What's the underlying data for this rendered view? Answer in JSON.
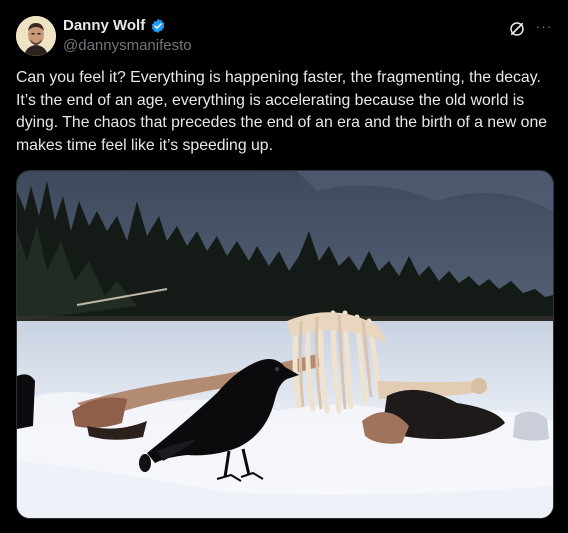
{
  "author": {
    "display_name": "Danny Wolf",
    "handle": "@dannysmanifesto",
    "verified": true,
    "verified_color": "#1d9bf0"
  },
  "header_actions": {
    "grok_icon": "grok-slash-icon",
    "more_label": "···"
  },
  "tweet": {
    "text": "Can you feel it? Everything is happening faster, the fragmenting, the decay. It’s the end of an age, everything is accelerating because the old world is dying. The chaos that precedes the end of an era and the birth of a new one makes time feel like it’s speeding up."
  },
  "media": {
    "kind": "photo",
    "subject": "raven-by-carcass-in-snow"
  },
  "colors": {
    "background": "#000000",
    "text_primary": "#e7e9ea",
    "text_secondary": "#71767b"
  }
}
